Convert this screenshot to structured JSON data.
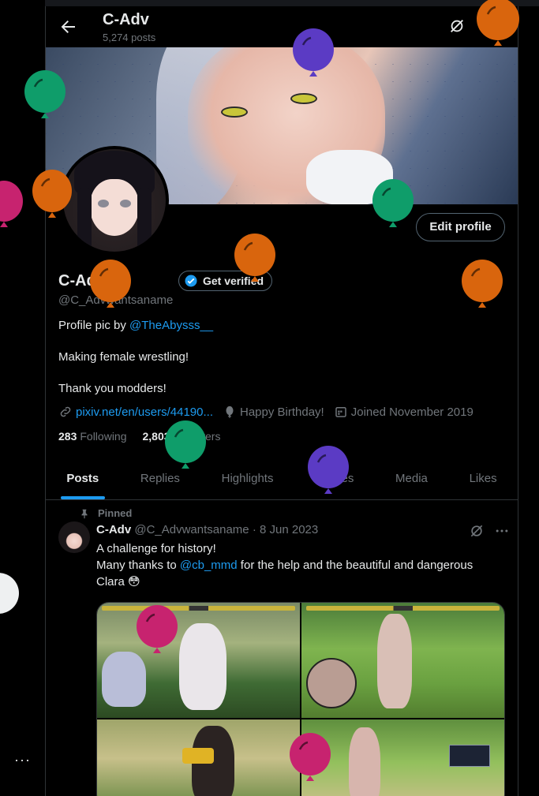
{
  "header": {
    "title": "C-Adv",
    "post_count": "5,274 posts"
  },
  "profile": {
    "name": "C-Adv",
    "handle": "@C_Advwantsaname",
    "edit_label": "Edit profile",
    "verify_label": "Get verified",
    "bio": {
      "line1_prefix": "Profile pic by ",
      "line1_link": "@TheAbysss__",
      "line2": "Making female wrestling!",
      "line3": "Thank you modders!"
    },
    "meta": {
      "website": "pixiv.net/en/users/44190...",
      "birthday": "Happy Birthday!",
      "joined": "Joined November 2019"
    },
    "following_count": "283",
    "following_label": "Following",
    "followers_count": "2,803",
    "followers_label": "Followers"
  },
  "tabs": [
    "Posts",
    "Replies",
    "Highlights",
    "Articles",
    "Media",
    "Likes"
  ],
  "post": {
    "pinned_label": "Pinned",
    "author": "C-Adv",
    "handle": "@C_Advwantsaname",
    "separator": "·",
    "date": "8 Jun 2023",
    "line1": "A challenge for history!",
    "line2_prefix": "Many thanks to ",
    "line2_link": "@cb_mmd",
    "line2_suffix": " for the help and the beautiful and dangerous",
    "line3": "Clara 😳"
  },
  "icons": {
    "back": "arrow-left-icon",
    "grok": "grok-icon",
    "search": "search-icon",
    "verified": "verified-badge-icon",
    "link": "link-icon",
    "balloon": "balloon-icon",
    "calendar": "calendar-icon",
    "pin": "pin-icon",
    "more": "more-dots-icon"
  },
  "colors": {
    "accent": "#1d9bf0",
    "background": "#000000",
    "muted": "#71767b",
    "balloon_green": "#0f9d6a",
    "balloon_orange": "#d9650d",
    "balloon_purple": "#5b3bc4",
    "balloon_pink": "#c7236f"
  },
  "sidebar": {
    "more_label": "···"
  }
}
